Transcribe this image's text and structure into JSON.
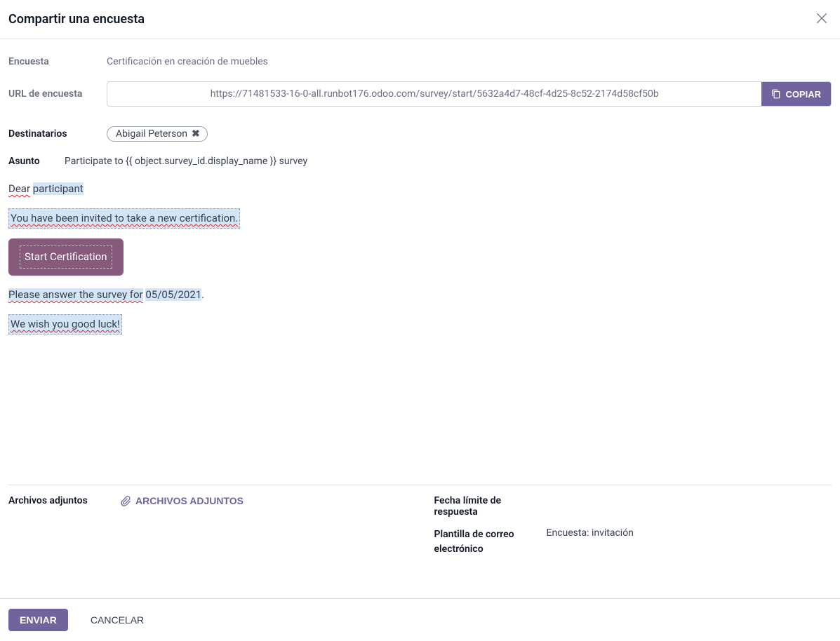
{
  "header": {
    "title": "Compartir una encuesta"
  },
  "labels": {
    "survey": "Encuesta",
    "survey_url": "URL de encuesta",
    "recipients": "Destinatarios",
    "subject": "Asunto",
    "attachments": "Archivos adjuntos",
    "deadline": "Fecha límite de respuesta",
    "mail_template": "Plantilla de correo electrónico"
  },
  "survey": {
    "name": "Certificación en creación de muebles",
    "url": "https://71481533-16-0-all.runbot176.odoo.com/survey/start/5632a4d7-48cf-4d25-8c52-2174d58cf50b"
  },
  "buttons": {
    "copy": "COPIAR",
    "send": "ENVIAR",
    "cancel": "CANCELAR",
    "attachments": "ARCHIVOS ADJUNTOS",
    "start_certification": "Start Certification"
  },
  "recipients": [
    {
      "name": "Abigail Peterson"
    }
  ],
  "subject": {
    "value": "Participate to {{ object.survey_id.display_name }} survey"
  },
  "body": {
    "dear": "Dear",
    "participant": "participant",
    "invited": "You have been invited to take a new certification.",
    "please_prefix": "Please answer the survey for",
    "deadline_date": "05/05/2021",
    "please_suffix": ".",
    "good_luck": "We wish you good luck!"
  },
  "template": {
    "value": "Encuesta: invitación"
  }
}
